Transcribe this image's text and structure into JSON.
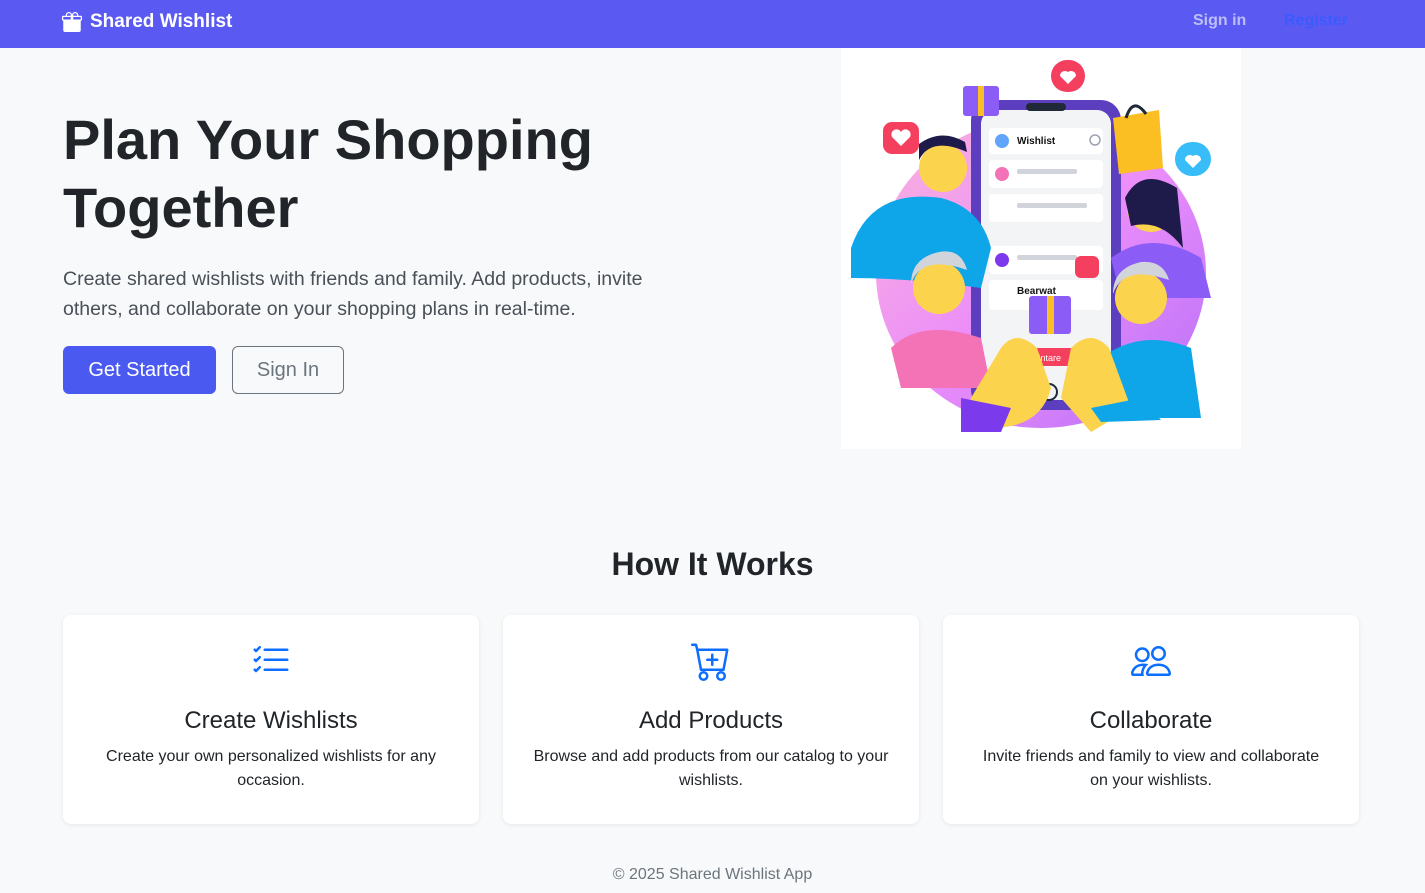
{
  "navbar": {
    "brand": "Shared Wishlist",
    "signin": "Sign in",
    "register": "Register"
  },
  "hero": {
    "title": "Plan Your Shopping Together",
    "lead": "Create shared wishlists with friends and family. Add products, invite others, and collaborate on your shopping plans in real-time.",
    "primary_button": "Get Started",
    "secondary_button": "Sign In",
    "illustration": {
      "app_header": "Wishlist",
      "list_item": "Bearwat",
      "button": "Intare"
    }
  },
  "how_it_works": {
    "title": "How It Works",
    "cards": [
      {
        "icon": "list-check-icon",
        "title": "Create Wishlists",
        "text": "Create your own personalized wishlists for any occasion."
      },
      {
        "icon": "cart-plus-icon",
        "title": "Add Products",
        "text": "Browse and add products from our catalog to your wishlists."
      },
      {
        "icon": "people-icon",
        "title": "Collaborate",
        "text": "Invite friends and family to view and collaborate on your wishlists."
      }
    ]
  },
  "footer": {
    "text": "© 2025 Shared Wishlist App"
  },
  "colors": {
    "navbar": "#5a5af2",
    "primary": "#4a5af0",
    "icon": "#0d6efd",
    "register_link": "#3b5bfd"
  }
}
